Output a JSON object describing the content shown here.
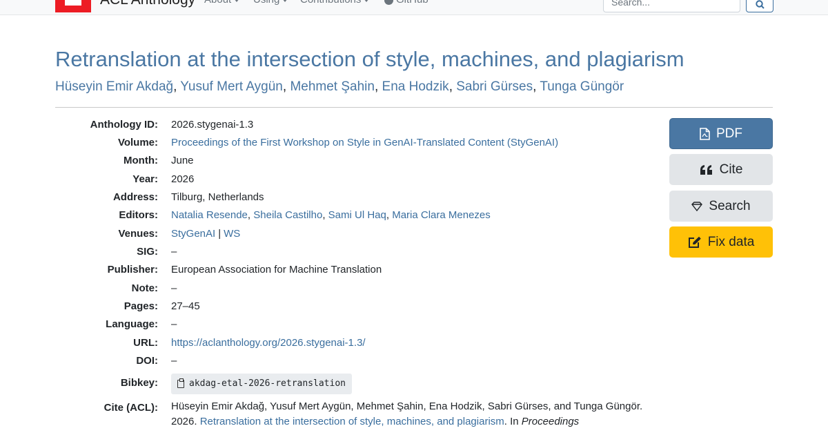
{
  "nav": {
    "brand": "ACL Anthology",
    "links": [
      {
        "label": "About"
      },
      {
        "label": "Using"
      },
      {
        "label": "Contributions"
      },
      {
        "label": "GitHub"
      }
    ],
    "search_placeholder": "Search..."
  },
  "paper": {
    "title": "Retranslation at the intersection of style, machines, and plagiarism",
    "authors": [
      "Hüseyin Emir Akdağ",
      "Yusuf Mert Aygün",
      "Mehmet Şahin",
      "Ena Hodzik",
      "Sabri Gürses",
      "Tunga Güngör"
    ],
    "author_sep": ","
  },
  "details": {
    "anthology_id": {
      "label": "Anthology ID:",
      "value": "2026.stygenai-1.3"
    },
    "volume": {
      "label": "Volume:",
      "value": "Proceedings of the First Workshop on Style in GenAI-Translated Content (StyGenAI)"
    },
    "month": {
      "label": "Month:",
      "value": "June"
    },
    "year": {
      "label": "Year:",
      "value": "2026"
    },
    "address": {
      "label": "Address:",
      "value": "Tilburg, Netherlands"
    },
    "editors": {
      "label": "Editors:",
      "values": [
        "Natalia Resende",
        "Sheila Castilho",
        "Sami Ul Haq",
        "Maria Clara Menezes"
      ]
    },
    "venues": {
      "label": "Venues:",
      "values": [
        "StyGenAI",
        "WS"
      ],
      "sep": "|"
    },
    "sig": {
      "label": "SIG:",
      "value": "–"
    },
    "publisher": {
      "label": "Publisher:",
      "value": "European Association for Machine Translation"
    },
    "note": {
      "label": "Note:",
      "value": "–"
    },
    "pages": {
      "label": "Pages:",
      "value": "27–45"
    },
    "language": {
      "label": "Language:",
      "value": "–"
    },
    "url": {
      "label": "URL:",
      "value": "https://aclanthology.org/2026.stygenai-1.3/"
    },
    "doi": {
      "label": "DOI:",
      "value": "–"
    },
    "bibkey": {
      "label": "Bibkey:",
      "value": "akdag-etal-2026-retranslation"
    },
    "cite_acl": {
      "label": "Cite (ACL):",
      "prefix": "Hüseyin Emir Akdağ, Yusuf Mert Aygün, Mehmet Şahin, Ena Hodzik, Sabri Gürses, and Tunga Güngör. 2026. ",
      "link": "Retranslation at the intersection of style, machines, and plagiarism",
      "suffix_plain": ". In ",
      "suffix_italic": "Proceedings"
    }
  },
  "buttons": {
    "pdf": "PDF",
    "cite": "Cite",
    "search": "Search",
    "fix": "Fix data"
  },
  "colors": {
    "link": "#3a6e9e",
    "title": "#4a77a3",
    "primary_button": "#4a77a3",
    "warning_button": "#ffc107",
    "logo_red": "#ed1c24"
  }
}
